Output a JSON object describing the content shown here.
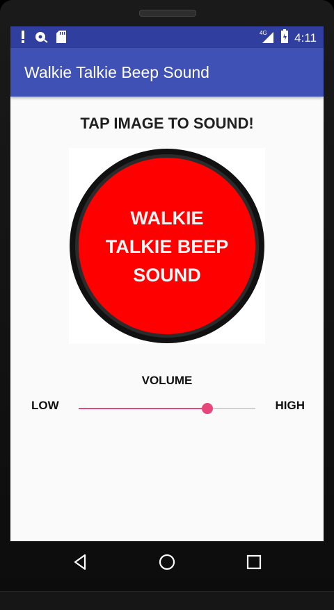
{
  "status_bar": {
    "time": "4:11",
    "network": "4G",
    "icons": [
      "alert-icon",
      "sync-icon",
      "sd-card-icon",
      "signal-icon",
      "battery-icon"
    ]
  },
  "app_bar": {
    "title": "Walkie Talkie Beep Sound",
    "color": "#3f51b5",
    "status_color": "#303f9f"
  },
  "main": {
    "instruction": "TAP IMAGE TO SOUND!",
    "image": {
      "lines": [
        "WALKIE",
        "TALKIE BEEP",
        "SOUND"
      ],
      "fill_color": "#ff0000"
    },
    "volume": {
      "label": "VOLUME",
      "low_label": "LOW",
      "high_label": "HIGH",
      "level": 0.73,
      "accent": "#e8457a"
    }
  },
  "nav_bar": {
    "buttons": [
      "back-icon",
      "home-icon",
      "recents-icon"
    ]
  }
}
